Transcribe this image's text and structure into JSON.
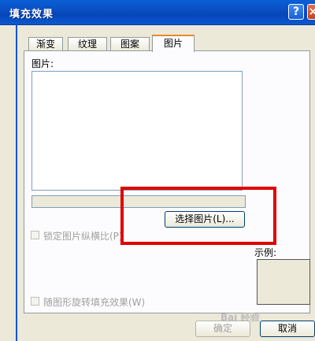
{
  "window": {
    "title": "填充效果",
    "help_label": "?",
    "close_label": "×"
  },
  "tabs": [
    {
      "label": "渐变"
    },
    {
      "label": "纹理"
    },
    {
      "label": "图案"
    },
    {
      "label": "图片",
      "active": true
    }
  ],
  "picture_panel": {
    "picture_label": "图片:",
    "select_button_label": "选择图片(L)...",
    "lock_aspect_label": "锁定图片纵横比(P)",
    "rotate_with_shape_label": "随图形旋转填充效果(W)",
    "sample_label": "示例:"
  },
  "footer": {
    "ok_label": "确定",
    "cancel_label": "取消"
  },
  "watermark_text": "Bai 经验",
  "colors": {
    "highlight": "#e00000",
    "titlebar": "#0a55d0",
    "active_tab_accent": "#e68b2c"
  }
}
